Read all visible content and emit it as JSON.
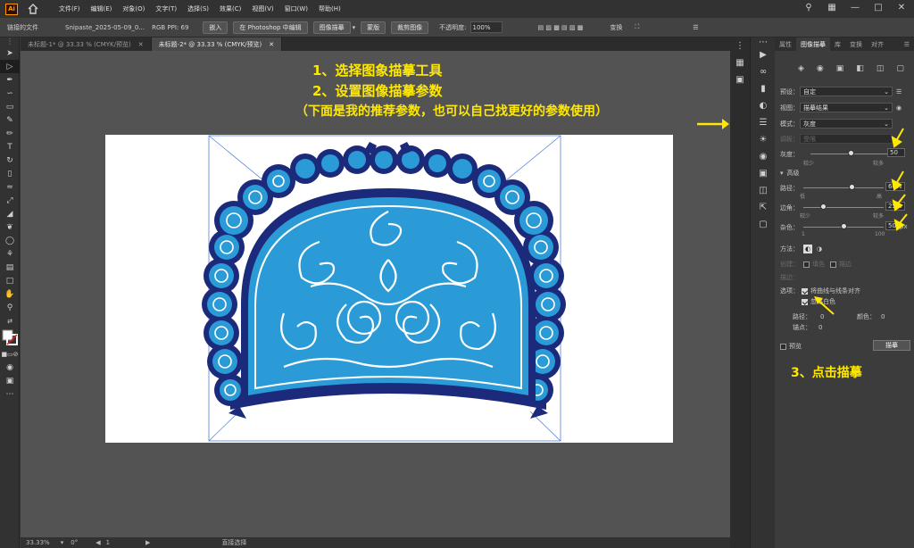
{
  "menubar": {
    "logo": "Ai",
    "items": [
      "文件(F)",
      "编辑(E)",
      "对象(O)",
      "文字(T)",
      "选择(S)",
      "效果(C)",
      "视图(V)",
      "窗口(W)",
      "帮助(H)"
    ]
  },
  "controlbar": {
    "linked_file": "链接的文件",
    "filename": "Snipaste_2025-05-09_0...",
    "color_info": "RGB  PPI: 69",
    "embed_btn": "嵌入",
    "ps_edit_btn": "在 Photoshop 中编辑",
    "trace_btn": "图像描摹",
    "mask_btn": "蒙版",
    "crop_btn": "裁剪图像",
    "opacity_label": "不透明度:",
    "opacity_value": "100%",
    "transform_label": "变换"
  },
  "doc_tabs": [
    {
      "label": "未标题-1* @ 33.33 % (CMYK/预览)",
      "active": false
    },
    {
      "label": "未标题-2* @ 33.33 % (CMYK/预览)",
      "active": true
    }
  ],
  "annotations": {
    "step1": "1、选择图象描摹工具",
    "step2": "2、设置图像描摹参数",
    "note": "（下面是我的推荐参数，也可以自己找更好的参数使用）",
    "step3": "3、点击描摹"
  },
  "statusbar": {
    "zoom": "33.33%",
    "angle": "0°",
    "page": "1",
    "tool": "直接选择"
  },
  "panel": {
    "tabs": [
      {
        "label": "属性",
        "active": false
      },
      {
        "label": "图像描摹",
        "active": true
      },
      {
        "label": "库",
        "active": false
      },
      {
        "label": "变换",
        "active": false
      },
      {
        "label": "对齐",
        "active": false
      }
    ],
    "preset_label": "预设：",
    "preset_value": "自定",
    "view_label": "视图：",
    "view_value": "描摹结果",
    "mode_label": "模式：",
    "mode_value": "灰度",
    "palette_label": "调板：",
    "palette_value": "受限",
    "gray_label": "灰度：",
    "gray_value": "50",
    "gray_level": 0.5,
    "less": "较少",
    "more": "较多",
    "advanced_label": "高级",
    "path_label": "路径：",
    "path_value": "60%",
    "path_level": 0.6,
    "low": "低",
    "high": "高",
    "corner_label": "边角：",
    "corner_value": "25%",
    "corner_level": 0.25,
    "noise_label": "杂色：",
    "noise_value": "50",
    "noise_unit": "px",
    "noise_level": 0.5,
    "noise_min": "1",
    "noise_max": "100",
    "method_label": "方法：",
    "fill_label": "创建：",
    "fill_opt": "填色",
    "stroke_opt": "描边",
    "stroke_label": "描边：",
    "options_label": "选项：",
    "snap_curves": "将曲线与线条对齐",
    "ignore_white": "忽略白色",
    "paths_stat_label": "路径：",
    "paths_stat": "0",
    "colors_stat_label": "颜色：",
    "colors_stat": "0",
    "anchors_stat_label": "锚点：",
    "anchors_stat": "0",
    "preview_label": "预览",
    "trace_button": "描摹"
  },
  "colors": {
    "annotation": "#ffe800",
    "accent": "#2a9bd6",
    "navy": "#1b2a7a"
  }
}
